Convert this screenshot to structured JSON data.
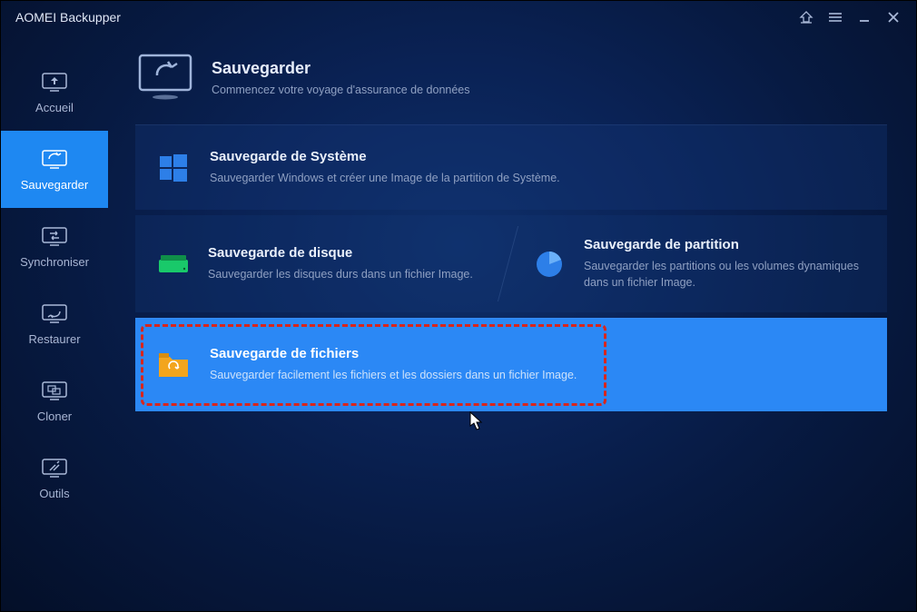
{
  "app_title": "AOMEI Backupper",
  "sidebar": {
    "items": [
      {
        "label": "Accueil"
      },
      {
        "label": "Sauvegarder"
      },
      {
        "label": "Synchroniser"
      },
      {
        "label": "Restaurer"
      },
      {
        "label": "Cloner"
      },
      {
        "label": "Outils"
      }
    ]
  },
  "main_header": {
    "title": "Sauvegarder",
    "subtitle": "Commencez votre voyage d'assurance de données"
  },
  "cards": {
    "system": {
      "title": "Sauvegarde de Système",
      "desc": "Sauvegarder Windows et créer une Image de la partition de Système."
    },
    "disk": {
      "title": "Sauvegarde de disque",
      "desc": "Sauvegarder les disques durs dans un fichier Image."
    },
    "partition": {
      "title": "Sauvegarde de partition",
      "desc": "Sauvegarder les partitions ou les volumes dynamiques dans un fichier Image."
    },
    "files": {
      "title": "Sauvegarde de fichiers",
      "desc": "Sauvegarder facilement les fichiers et les dossiers dans un fichier Image."
    }
  },
  "colors": {
    "accent": "#1e88f2",
    "highlight_border": "#d9261c"
  }
}
